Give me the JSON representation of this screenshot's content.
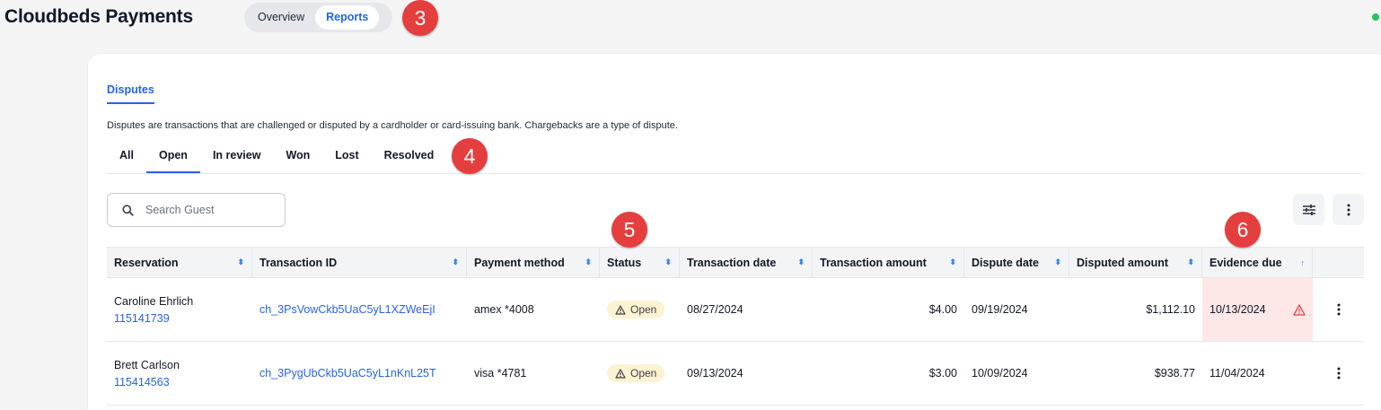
{
  "header": {
    "app_title": "Cloudbeds Payments",
    "view_tabs": [
      {
        "label": "Overview",
        "active": false
      },
      {
        "label": "Reports",
        "active": true
      }
    ]
  },
  "markers": [
    "3",
    "4",
    "5",
    "6"
  ],
  "colors": {
    "accent": "#2563eb",
    "marker": "#e53e3e",
    "online": "#22c55e",
    "overdue_bg": "#fde7e7",
    "open_badge_bg": "#fdf3d2"
  },
  "disputes": {
    "section_tab": "Disputes",
    "description": "Disputes are transactions that are challenged or disputed by a cardholder or card-issuing bank. Chargebacks are a type of dispute.",
    "status_tabs": [
      {
        "label": "All",
        "active": false
      },
      {
        "label": "Open",
        "active": true
      },
      {
        "label": "In review",
        "active": false
      },
      {
        "label": "Won",
        "active": false
      },
      {
        "label": "Lost",
        "active": false
      },
      {
        "label": "Resolved",
        "active": false
      }
    ],
    "search": {
      "placeholder": "Search Guest",
      "value": "",
      "icon": "search-icon"
    },
    "toolbar": {
      "filter_icon": "sliders-icon",
      "more_icon": "more-vertical-icon"
    },
    "table": {
      "columns": [
        "Reservation",
        "Transaction ID",
        "Payment method",
        "Status",
        "Transaction date",
        "Transaction amount",
        "Dispute date",
        "Disputed amount",
        "Evidence due"
      ],
      "rows": [
        {
          "guest": "Caroline Ehrlich",
          "reservation_id": "115141739",
          "transaction_id": "ch_3PsVowCkb5UaC5yL1XZWeEjI",
          "payment_method": "amex *4008",
          "status": "Open",
          "transaction_date": "08/27/2024",
          "transaction_amount": "$4.00",
          "dispute_date": "09/19/2024",
          "disputed_amount": "$1,112.10",
          "evidence_due": "10/13/2024",
          "evidence_overdue": true
        },
        {
          "guest": "Brett Carlson",
          "reservation_id": "115414563",
          "transaction_id": "ch_3PygUbCkb5UaC5yL1nKnL25T",
          "payment_method": "visa *4781",
          "status": "Open",
          "transaction_date": "09/13/2024",
          "transaction_amount": "$3.00",
          "dispute_date": "10/09/2024",
          "disputed_amount": "$938.77",
          "evidence_due": "11/04/2024",
          "evidence_overdue": false
        }
      ]
    }
  }
}
